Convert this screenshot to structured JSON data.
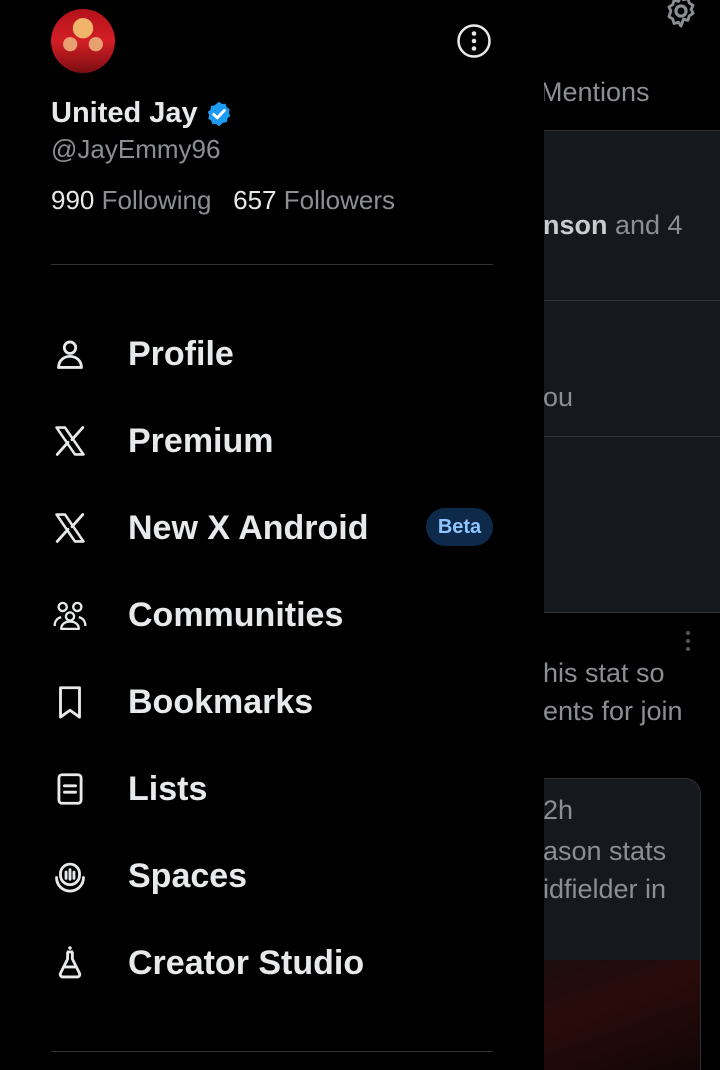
{
  "background": {
    "tab_label": "Mentions",
    "item1_name": "nson",
    "item1_rest": " and 4",
    "item2_text": "ou",
    "post_line1": "his stat so",
    "post_line2": "ents for join",
    "quote_time": "2h",
    "quote_line1": "ason stats",
    "quote_line2": "idfielder in"
  },
  "drawer": {
    "display_name": "United Jay",
    "handle": "@JayEmmy96",
    "following_count": "990",
    "following_label": "Following",
    "followers_count": "657",
    "followers_label": "Followers",
    "menu": [
      {
        "label": "Profile",
        "icon": "person-icon"
      },
      {
        "label": "Premium",
        "icon": "x-logo-icon"
      },
      {
        "label": "New X Android",
        "icon": "x-logo-icon",
        "badge": "Beta"
      },
      {
        "label": "Communities",
        "icon": "communities-icon"
      },
      {
        "label": "Bookmarks",
        "icon": "bookmark-icon"
      },
      {
        "label": "Lists",
        "icon": "list-icon"
      },
      {
        "label": "Spaces",
        "icon": "spaces-icon"
      },
      {
        "label": "Creator Studio",
        "icon": "creator-studio-icon"
      }
    ]
  },
  "colors": {
    "background": "#000000",
    "text_primary": "#e7e9ea",
    "text_secondary": "#8b8f93",
    "verified_blue": "#1d9bf0",
    "beta_bg": "#0d2a4a",
    "beta_text": "#8ec5ff"
  }
}
